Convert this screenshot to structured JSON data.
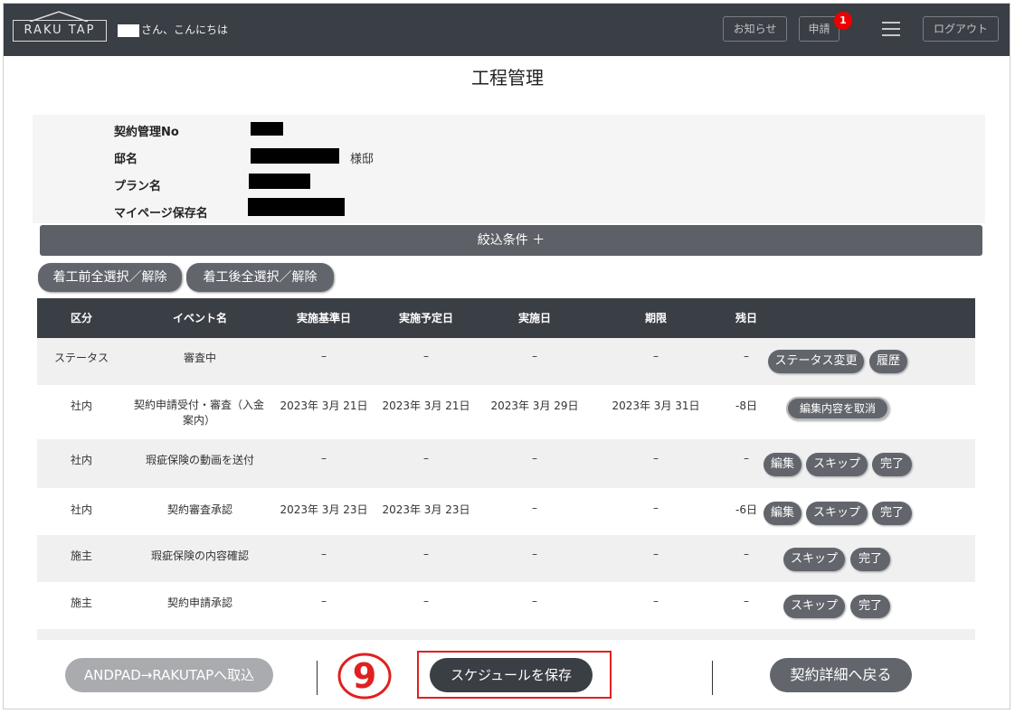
{
  "header": {
    "logo": "RAKU TAP",
    "greeting": "さん、こんにちは",
    "notice_label": "お知らせ",
    "request_label": "申請",
    "request_badge": "1",
    "logout_label": "ログアウト"
  },
  "page": {
    "title": "工程管理"
  },
  "info": {
    "contract_no_label": "契約管理No",
    "house_label": "邸名",
    "house_suffix": "様邸",
    "plan_label": "プラン名",
    "mypage_label": "マイページ保存名"
  },
  "filter": {
    "label": "絞込条件 ＋"
  },
  "select_buttons": {
    "before": "着工前全選択／解除",
    "after": "着工後全選択／解除"
  },
  "table": {
    "headers": [
      "区分",
      "イベント名",
      "実施基準日",
      "実施予定日",
      "実施日",
      "期限",
      "残日"
    ],
    "rows": [
      {
        "category": "ステータス",
        "event": "審査中",
        "base": "–",
        "planned": "–",
        "done": "–",
        "deadline": "–",
        "remaining": "–",
        "actions": [
          "ステータス変更",
          "履歴"
        ]
      },
      {
        "category": "社内",
        "event": "契約申請受付・審査（入金案内）",
        "base": "2023年 3月 21日",
        "planned": "2023年 3月 21日",
        "done": "2023年 3月 29日",
        "deadline": "2023年 3月 31日",
        "remaining": "-8日",
        "actions": [
          "編集内容を取消"
        ]
      },
      {
        "category": "社内",
        "event": "瑕疵保険の動画を送付",
        "base": "–",
        "planned": "–",
        "done": "–",
        "deadline": "–",
        "remaining": "–",
        "actions": [
          "編集",
          "スキップ",
          "完了"
        ]
      },
      {
        "category": "社内",
        "event": "契約審査承認",
        "base": "2023年 3月 23日",
        "planned": "2023年 3月 23日",
        "done": "–",
        "deadline": "–",
        "remaining": "-6日",
        "actions": [
          "編集",
          "スキップ",
          "完了"
        ]
      },
      {
        "category": "施主",
        "event": "瑕疵保険の内容確認",
        "base": "–",
        "planned": "–",
        "done": "–",
        "deadline": "–",
        "remaining": "–",
        "actions": [
          "スキップ",
          "完了"
        ]
      },
      {
        "category": "施主",
        "event": "契約申請承認",
        "base": "–",
        "planned": "–",
        "done": "–",
        "deadline": "–",
        "remaining": "–",
        "actions": [
          "スキップ",
          "完了"
        ]
      }
    ]
  },
  "footer": {
    "import_label": "ANDPAD→RAKUTAPへ取込",
    "save_label": "スケジュールを保存",
    "back_label": "契約詳細へ戻る",
    "step_number": "9"
  },
  "colors": {
    "header": "#3a3e45",
    "button": "#62666c",
    "highlight": "#e02020",
    "badge": "#ee0000"
  }
}
